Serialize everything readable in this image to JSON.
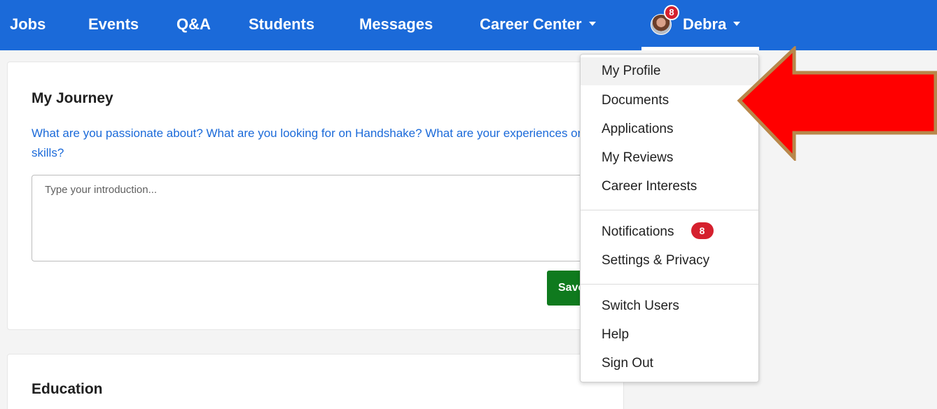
{
  "nav": {
    "items": [
      "Jobs",
      "Events",
      "Q&A",
      "Students",
      "Messages",
      "Career Center"
    ],
    "user_name": "Debra",
    "notification_count": "8"
  },
  "journey": {
    "title": "My Journey",
    "prompt": "What are you passionate about? What are you looking for on Handshake? What are your experiences or skills?",
    "intro_placeholder": "Type your introduction...",
    "intro_value": "",
    "save_label": "Save"
  },
  "education": {
    "title": "Education"
  },
  "dropdown": {
    "group1": [
      "My Profile",
      "Documents",
      "Applications",
      "My Reviews",
      "Career Interests"
    ],
    "group2": [
      "Notifications",
      "Settings & Privacy"
    ],
    "notifications_badge": "8",
    "group3": [
      "Switch Users",
      "Help",
      "Sign Out"
    ]
  },
  "colors": {
    "nav_bg": "#1b6ad9",
    "link_blue": "#1b6ad9",
    "save_green": "#0f7a1e",
    "badge_red": "#d5202e",
    "arrow_red": "#ff0000",
    "arrow_outline": "#b8874a"
  },
  "icons": {
    "caret": "chevron-down-icon",
    "avatar": "user-avatar",
    "arrow": "red-pointer-arrow"
  }
}
